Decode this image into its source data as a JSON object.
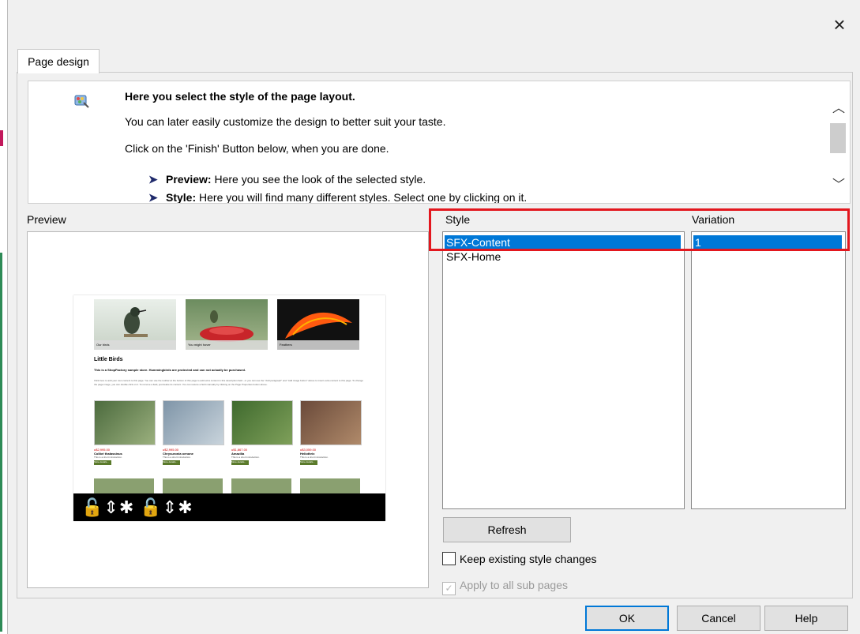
{
  "window": {
    "close_glyph": "×"
  },
  "tab": {
    "label": "Page design"
  },
  "info": {
    "icon": "page-style-wizard-icon",
    "heading": "Here you select the style of the page layout.",
    "line1": "You can later easily customize the design to better suit your taste.",
    "line2": "Click on the 'Finish' Button below, when you are done.",
    "bullets": [
      {
        "term": "Preview:",
        "text": " Here you see the look of the selected style."
      },
      {
        "term": "Style:",
        "text": " Here you will find many different styles. Select one by clicking on it."
      }
    ]
  },
  "preview": {
    "label": "Preview",
    "thumbnail": {
      "captions": [
        "Our birds",
        "You might hover",
        "Feathers"
      ],
      "title": "Little Birds",
      "subtitle": "This is a ShopFactory sample store. Hummingbirds are protected and can not actually be purchased.",
      "body": "Click here to add your own content to this page. You can use the toolbar at the bottom of this page to add extra content in this description field - or you can use the \"Add paragraph\" and \"Add image button\" above to insert extra content to this page. To change the page image, you can double click on it. To remove a field, just delete its content. You can restore a field manually by clicking on the Page Properties button above.",
      "products": [
        {
          "price": "u$2,995.00",
          "name": "Colibri thalassinus",
          "desc": "This is a short introduction.",
          "btn": "More details..."
        },
        {
          "price": "u$2,995.00",
          "name": "Chrysuronia oenone",
          "desc": "This is a short introduction.",
          "btn": "More details..."
        },
        {
          "price": "u$1,867.00",
          "name": "Amazilia",
          "desc": "This is a short introduction.",
          "btn": "More details..."
        },
        {
          "price": "u$3,059.00",
          "name": "Heliothrix",
          "desc": "This is a short introduction.",
          "btn": "More details..."
        }
      ],
      "toolbar_glyphs": "🔓⇕✱ 🔓⇕✱"
    }
  },
  "style": {
    "header": "Style",
    "items": [
      "SFX-Content",
      "SFX-Home"
    ],
    "selected_index": 0
  },
  "variation": {
    "header": "Variation",
    "items": [
      "1"
    ],
    "selected_index": 0
  },
  "buttons": {
    "refresh": "Refresh",
    "ok": "OK",
    "cancel": "Cancel",
    "help": "Help"
  },
  "options": {
    "keep_changes": {
      "label": "Keep existing style changes",
      "checked": false
    },
    "apply_sub_pages": {
      "label": "Apply to all sub pages",
      "checked": true,
      "disabled": true
    }
  },
  "colors": {
    "selection": "#0078d7",
    "annotation_outline": "#e3171e"
  }
}
